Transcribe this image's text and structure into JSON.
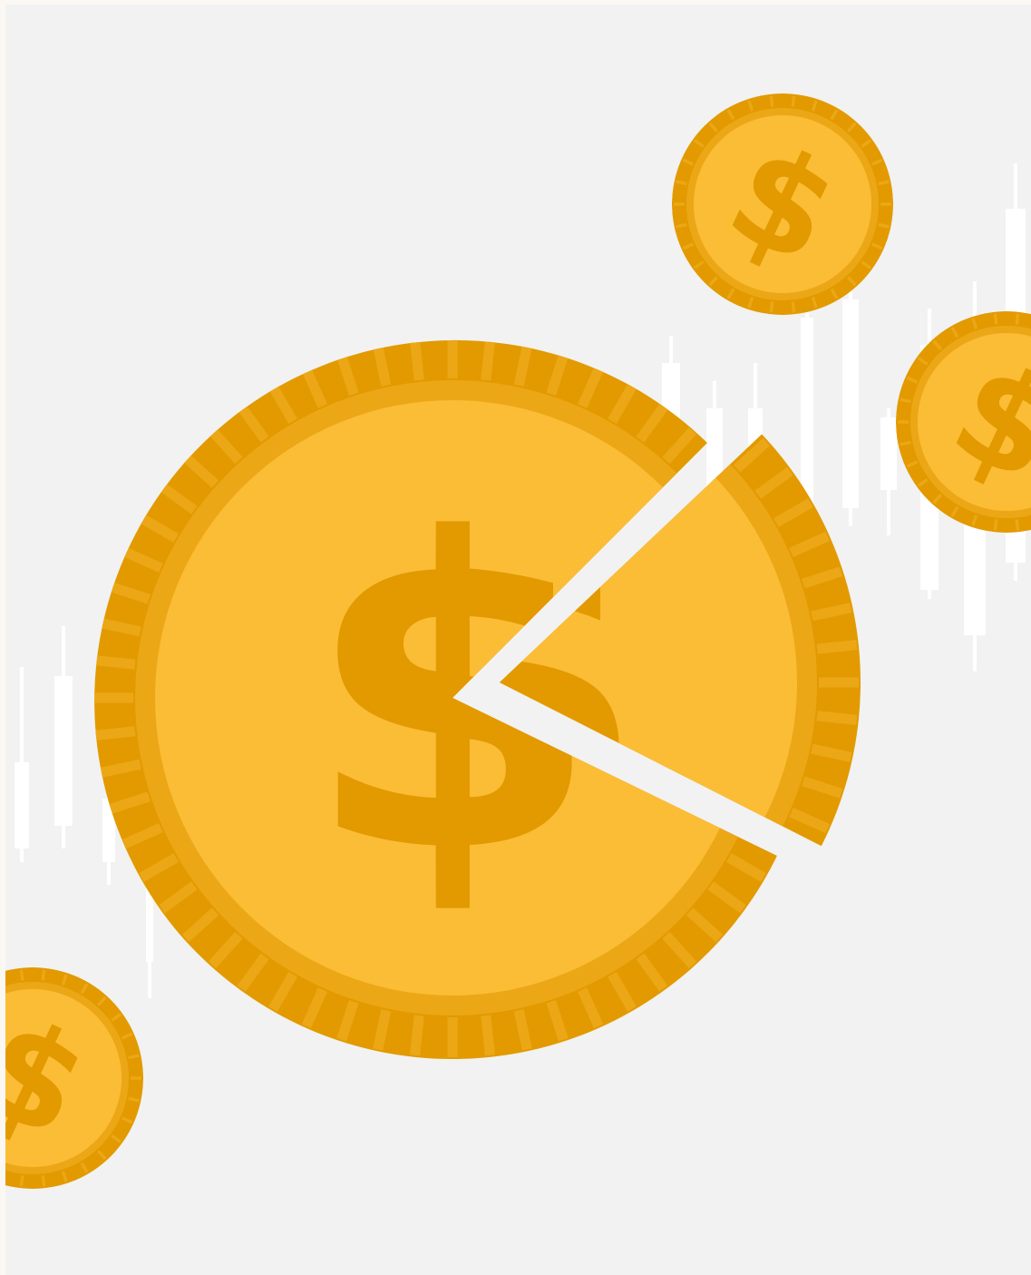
{
  "illustration": {
    "symbol": "$",
    "colors": {
      "background": "#f2f2f2",
      "page_edge": "#fbf8f3",
      "coin_face": "#fbbd36",
      "coin_rim": "#e29a00",
      "rim_stripe": "#eca716",
      "symbol": "#e29a00",
      "symbol_shade": "#eca716",
      "candles": "#ffffff"
    },
    "coins": [
      {
        "name": "coin-large-sliced",
        "icon": "dollar-coin-icon",
        "has_slice_removed": true
      },
      {
        "name": "coin-top",
        "icon": "dollar-coin-icon"
      },
      {
        "name": "coin-right",
        "icon": "dollar-coin-icon"
      },
      {
        "name": "coin-bottom-left",
        "icon": "dollar-coin-icon"
      }
    ],
    "background_motif": "candlestick-chart-icon"
  }
}
